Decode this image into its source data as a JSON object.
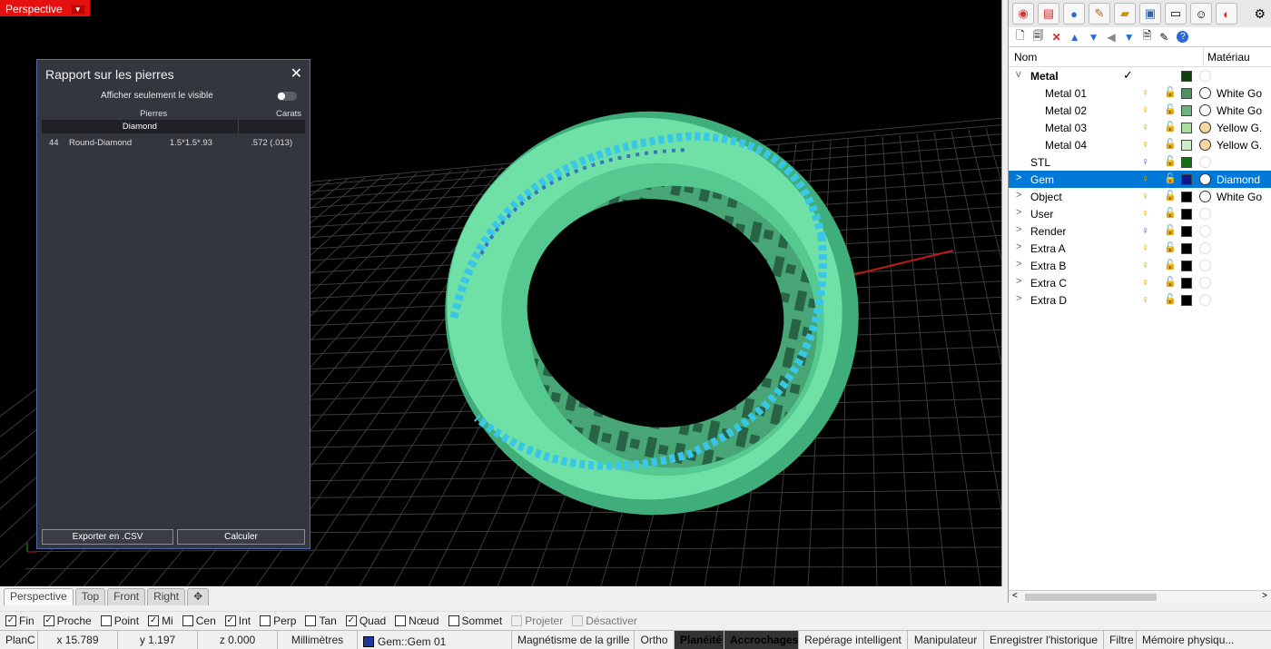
{
  "viewport": {
    "label": "Perspective",
    "caret": "▼"
  },
  "report": {
    "title": "Rapport sur les pierres",
    "close": "✕",
    "visible_label": "Afficher seulement le visible",
    "col_stones": "Pierres",
    "col_carats": "Carats",
    "group": "Diamond",
    "rows": [
      {
        "count": "44",
        "shape": "Round-Diamond",
        "size": "1.5*1.5*.93",
        "carats": ".572 (.013)"
      }
    ],
    "export_btn": "Exporter en .CSV",
    "calc_btn": "Calculer"
  },
  "layers": {
    "col_name": "Nom",
    "col_material": "Matériau",
    "items": [
      {
        "name": "Metal",
        "expand": "v",
        "bold": true,
        "check": "✓",
        "bulb": "",
        "lock": "",
        "swatch": "#0f3f0f",
        "mat": "",
        "circle": "empty",
        "mcolor": "#fff",
        "indent": 0
      },
      {
        "name": "Metal 01",
        "expand": "",
        "check": "",
        "bulb": "💡",
        "lock": "🔓",
        "swatch": "#4f8f60",
        "mat": "White Go",
        "circle": "full",
        "mcolor": "#fff",
        "indent": 1
      },
      {
        "name": "Metal 02",
        "expand": "",
        "check": "",
        "bulb": "💡",
        "lock": "🔓",
        "swatch": "#6fb37f",
        "mat": "White Go",
        "circle": "full",
        "mcolor": "#fff",
        "indent": 1
      },
      {
        "name": "Metal 03",
        "expand": "",
        "check": "",
        "bulb": "💡",
        "lock": "🔓",
        "swatch": "#a9e0a0",
        "mat": "Yellow G.",
        "circle": "full",
        "mcolor": "#f5d9a0",
        "indent": 1
      },
      {
        "name": "Metal 04",
        "expand": "",
        "check": "",
        "bulb": "💡",
        "lock": "🔓",
        "swatch": "#cdeec9",
        "mat": "Yellow G.",
        "circle": "full",
        "mcolor": "#f5d9a0",
        "indent": 1
      },
      {
        "name": "STL",
        "expand": "",
        "check": "",
        "bulb": "💡",
        "lock": "🔓",
        "swatch": "#127012",
        "mat": "",
        "circle": "empty",
        "mcolor": "#fff",
        "indent": 0
      },
      {
        "name": "Gem",
        "expand": ">",
        "check": "",
        "bulb": "💡",
        "lock": "🔓",
        "swatch": "#0a1a8a",
        "mat": "Diamond",
        "circle": "full",
        "mcolor": "#fff",
        "indent": 0,
        "selected": true
      },
      {
        "name": "Object",
        "expand": ">",
        "check": "",
        "bulb": "💡",
        "lock": "🔓",
        "swatch": "#000",
        "mat": "White Go",
        "circle": "full",
        "mcolor": "#fff",
        "indent": 0
      },
      {
        "name": "User",
        "expand": ">",
        "check": "",
        "bulb": "💡",
        "lock": "🔓",
        "swatch": "#000",
        "mat": "",
        "circle": "empty",
        "mcolor": "#fff",
        "indent": 0
      },
      {
        "name": "Render",
        "expand": ">",
        "check": "",
        "bulb": "💡",
        "lock": "🔓",
        "swatch": "#000",
        "mat": "",
        "circle": "empty",
        "mcolor": "#fff",
        "indent": 0
      },
      {
        "name": "Extra A",
        "expand": ">",
        "check": "",
        "bulb": "💡",
        "lock": "🔓",
        "swatch": "#000",
        "mat": "",
        "circle": "empty",
        "mcolor": "#fff",
        "indent": 0
      },
      {
        "name": "Extra B",
        "expand": ">",
        "check": "",
        "bulb": "💡",
        "lock": "🔓",
        "swatch": "#000",
        "mat": "",
        "circle": "empty",
        "mcolor": "#fff",
        "indent": 0
      },
      {
        "name": "Extra C",
        "expand": ">",
        "check": "",
        "bulb": "💡",
        "lock": "🔓",
        "swatch": "#000",
        "mat": "",
        "circle": "empty",
        "mcolor": "#fff",
        "indent": 0
      },
      {
        "name": "Extra D",
        "expand": ">",
        "check": "",
        "bulb": "💡",
        "lock": "🔓",
        "swatch": "#000",
        "mat": "",
        "circle": "empty",
        "mcolor": "#fff",
        "indent": 0
      }
    ]
  },
  "viewtabs": [
    "Perspective",
    "Top",
    "Front",
    "Right"
  ],
  "osnaps": [
    {
      "label": "Fin",
      "checked": true
    },
    {
      "label": "Proche",
      "checked": true
    },
    {
      "label": "Point",
      "checked": false
    },
    {
      "label": "Mi",
      "checked": true
    },
    {
      "label": "Cen",
      "checked": false
    },
    {
      "label": "Int",
      "checked": true
    },
    {
      "label": "Perp",
      "checked": false
    },
    {
      "label": "Tan",
      "checked": false
    },
    {
      "label": "Quad",
      "checked": true
    },
    {
      "label": "Nœud",
      "checked": false
    },
    {
      "label": "Sommet",
      "checked": false
    },
    {
      "label": "Projeter",
      "checked": false,
      "disabled": true
    },
    {
      "label": "Désactiver",
      "checked": false,
      "disabled": true
    }
  ],
  "status": {
    "cplane": "PlanC",
    "x": "x 15.789",
    "y": "y 1.197",
    "z": "z 0.000",
    "units": "Millimètres",
    "layer": "Gem::Gem 01",
    "grid_snap": "Magnétisme de la grille",
    "ortho": "Ortho",
    "planar": "Planéité",
    "osnap": "Accrochages",
    "smarttrack": "Repérage intelligent",
    "gumball": "Manipulateur",
    "history": "Enregistrer l'historique",
    "filter": "Filtre",
    "memory": "Mémoire physiqu..."
  },
  "colors": {
    "ring": "#5fd69a",
    "gem": "#39c7e8",
    "rhino_red": "#e51010",
    "selection": "#0078d7"
  }
}
